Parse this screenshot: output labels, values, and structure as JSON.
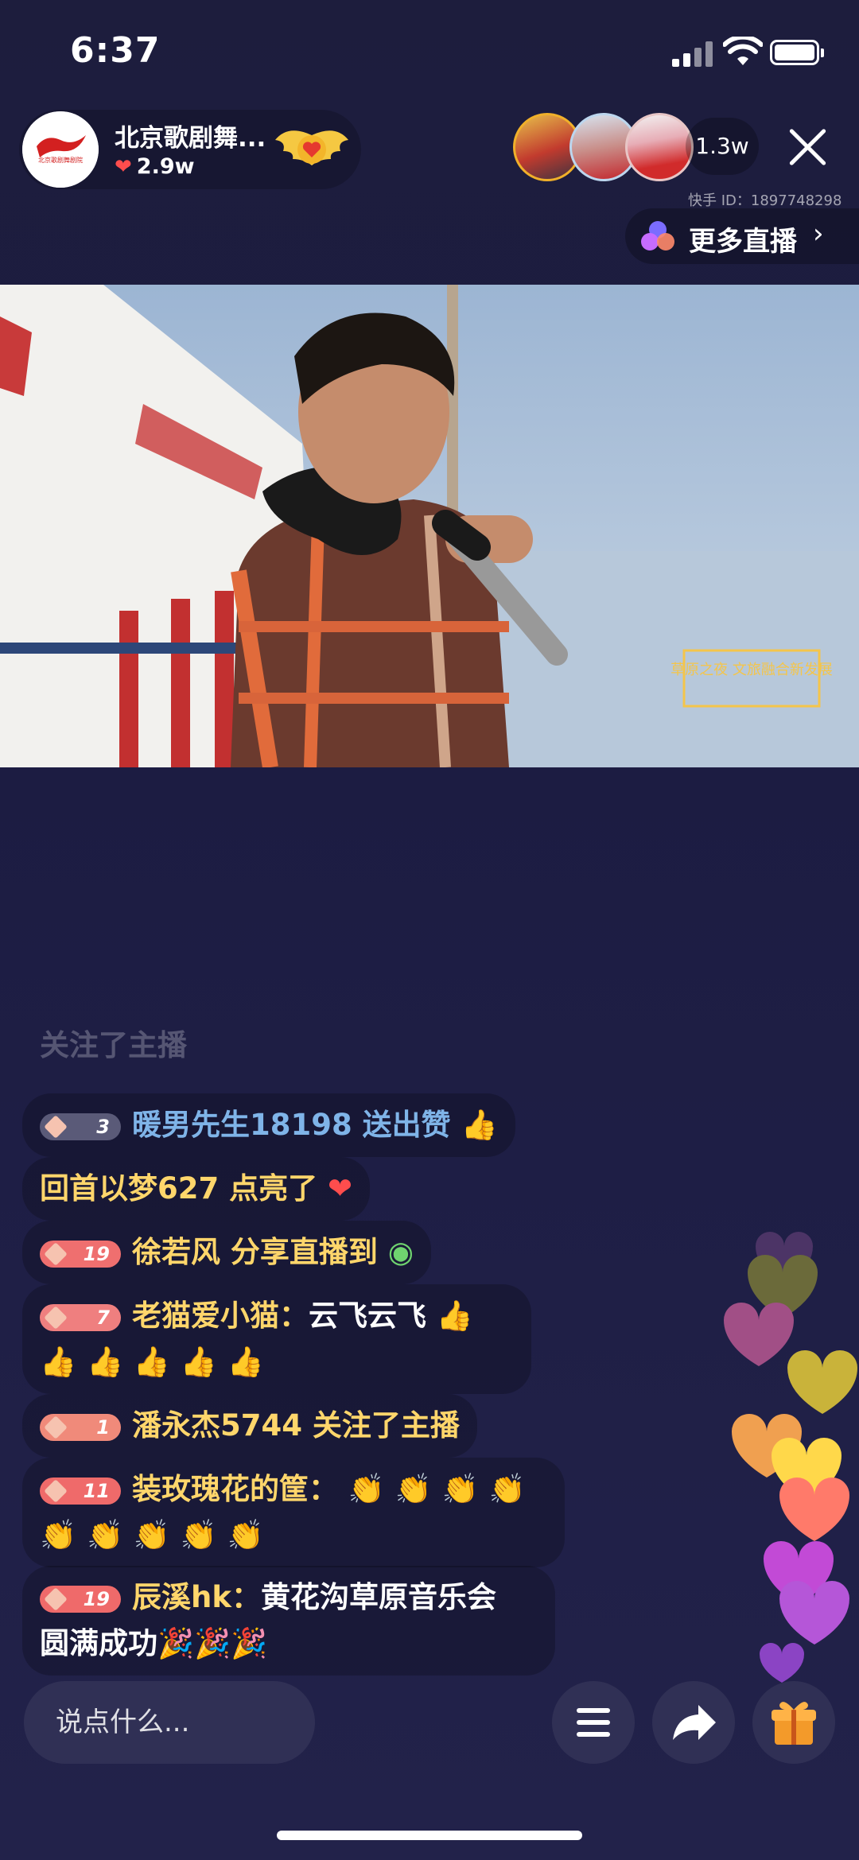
{
  "status_bar": {
    "time": "6:37"
  },
  "streamer": {
    "name": "北京歌剧舞...",
    "likes": "2.9w",
    "avatar_logo_text": "北京歌剧舞剧院"
  },
  "viewers": {
    "count": "1.3w"
  },
  "kuaishou_id": "快手 ID：1897748298",
  "more_live": {
    "label": "更多直播"
  },
  "video": {
    "overlay_text": "草原之夜 文旅融合新发展"
  },
  "chat": [
    {
      "text": "关注了主播",
      "style": "faded"
    },
    {
      "level": "3",
      "user": "暖男先生18198",
      "action": "送出赞",
      "emoji": "👍"
    },
    {
      "level": "",
      "user": "回首以梦627",
      "action": "点亮了",
      "emoji": "❤"
    },
    {
      "level": "19",
      "user": "徐若风",
      "action": "分享直播到",
      "emoji": "◉"
    },
    {
      "level": "7",
      "user": "老猫爱小猫：",
      "action": "云飞云飞",
      "emoji": "👍",
      "line2": "👍 👍 👍 👍 👍"
    },
    {
      "level": "1",
      "user": "潘永杰5744",
      "action": "关注了主播",
      "emoji": ""
    },
    {
      "level": "11",
      "user": "装玫瑰花的筐：",
      "action": "👏 👏 👏 👏",
      "emoji": "",
      "line2": "👏 👏 👏 👏 👏"
    },
    {
      "level": "19",
      "user": "辰溪hk：",
      "action": "黄花沟草原音乐会",
      "emoji": "",
      "line2": "圆满成功🎉🎉🎉"
    }
  ],
  "bottom": {
    "input_placeholder": "说点什么...",
    "menu_icon": "menu-icon",
    "share_icon": "share-icon",
    "gift_icon": "gift-icon"
  },
  "colors": {
    "background": "#1c1c40",
    "username": "#7fd0ff",
    "gold_text": "#ffd66b",
    "heart": "#ff4d4d"
  }
}
